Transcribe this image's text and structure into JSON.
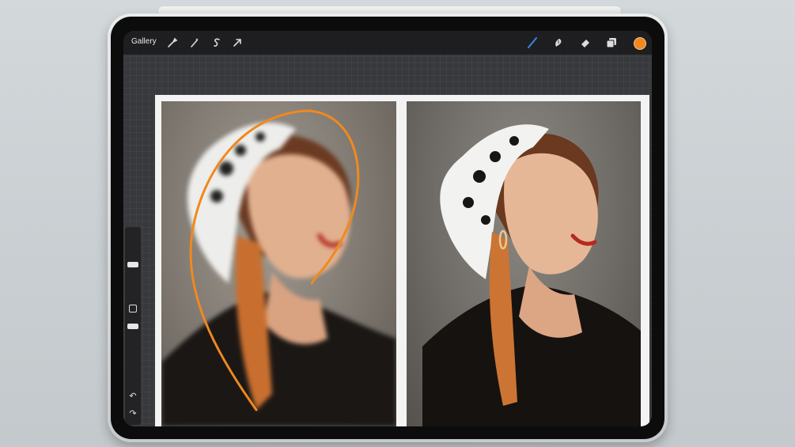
{
  "toolbar": {
    "gallery_label": "Gallery",
    "left_tools": [
      "wrench-icon",
      "magic-wand-icon",
      "selection-icon",
      "transform-icon"
    ],
    "right_tools": [
      "brush-icon",
      "smudge-icon",
      "eraser-icon",
      "layers-icon"
    ],
    "active_tool": "brush-icon",
    "current_color": "#f0891f"
  },
  "sidebar": {
    "brush_size_icon": "slider-handle",
    "opacity_icon": "slider-handle",
    "modify_icon": "square-icon",
    "undo_glyph": "↶",
    "redo_glyph": "↷"
  },
  "canvas": {
    "stroke_color": "#f0891f",
    "panels": [
      "painted-portrait",
      "reference-photo"
    ]
  }
}
